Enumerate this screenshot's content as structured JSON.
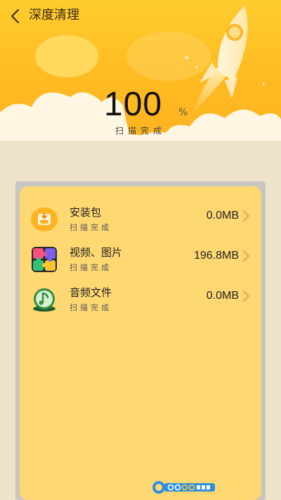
{
  "header": {
    "title": "深度清理",
    "percent_value": "100",
    "percent_unit": "%",
    "status": "扫描完成",
    "progress_fraction": 1.0
  },
  "items": [
    {
      "label": "安装包",
      "status": "扫描完成",
      "size": "0.0MB",
      "icon": "package-icon"
    },
    {
      "label": "视频、图片",
      "status": "扫描完成",
      "size": "196.8MB",
      "icon": "puzzle-media-icon"
    },
    {
      "label": "音频文件",
      "status": "扫描完成",
      "size": "0.0MB",
      "icon": "music-note-icon"
    }
  ],
  "watermark": {
    "text": "GOGO手游网"
  },
  "colors": {
    "header_yellow": "#ffc12a",
    "card_yellow": "#ffd872",
    "page_background": "#efe2ca",
    "arrow_orange": "#f2a24a"
  }
}
